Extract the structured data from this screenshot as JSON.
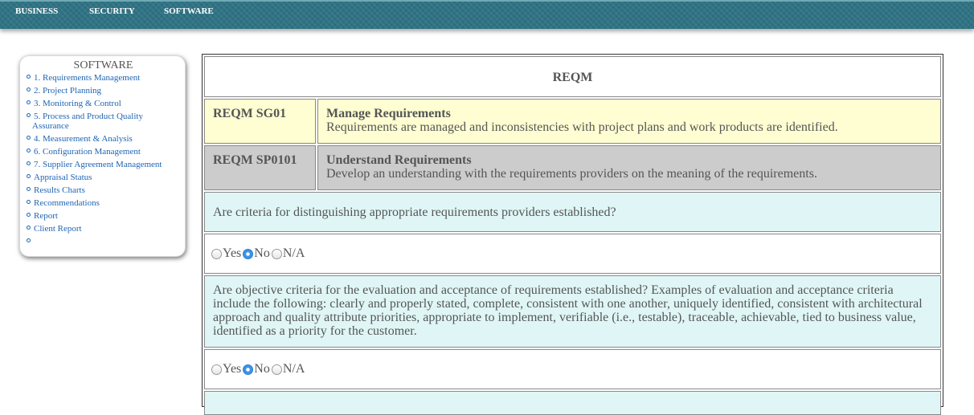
{
  "topnav": [
    "BUSINESS",
    "SECURITY",
    "SOFTWARE"
  ],
  "sidebar": {
    "title": "SOFTWARE",
    "items": [
      "1. Requirements Management",
      "2. Project Planning",
      "3. Monitoring & Control",
      "5. Process and Product Quality Assurance",
      "4. Measurement & Analysis",
      "6. Configuration Management",
      "7. Supplier Agreement Management",
      "Appraisal Status",
      "Results Charts",
      "Recommendations",
      "Report",
      "Client Report",
      ""
    ]
  },
  "main": {
    "header": "REQM",
    "goal": {
      "code": "REQM SG01",
      "title": "Manage Requirements",
      "desc": "Requirements are managed and inconsistencies with project plans and work products are identified."
    },
    "practice": {
      "code": "REQM SP0101",
      "title": "Understand Requirements",
      "desc": "Develop an understanding with the requirements providers on the meaning of the requirements."
    },
    "questions": [
      {
        "text": "Are criteria for distinguishing appropriate requirements providers established?",
        "selected": "No"
      },
      {
        "text": "Are objective criteria for the evaluation and acceptance of requirements established? Examples of evaluation and acceptance criteria include the following: clearly and properly stated, complete, consistent with one another, uniquely identified, consistent with architectural approach and quality attribute priorities, appropriate to implement, verifiable (i.e., testable), traceable, achievable, tied to business value, identified as a priority for the customer.",
        "selected": "No"
      }
    ],
    "options": [
      "Yes",
      "No",
      "N/A"
    ]
  },
  "colors": {
    "topbar": "#2f7384",
    "link": "#1e64b4",
    "goal_bg": "#fefed2",
    "practice_bg": "#cccccc",
    "question_bg": "#e0f6f6",
    "radio_selected": "#3b93ea"
  }
}
